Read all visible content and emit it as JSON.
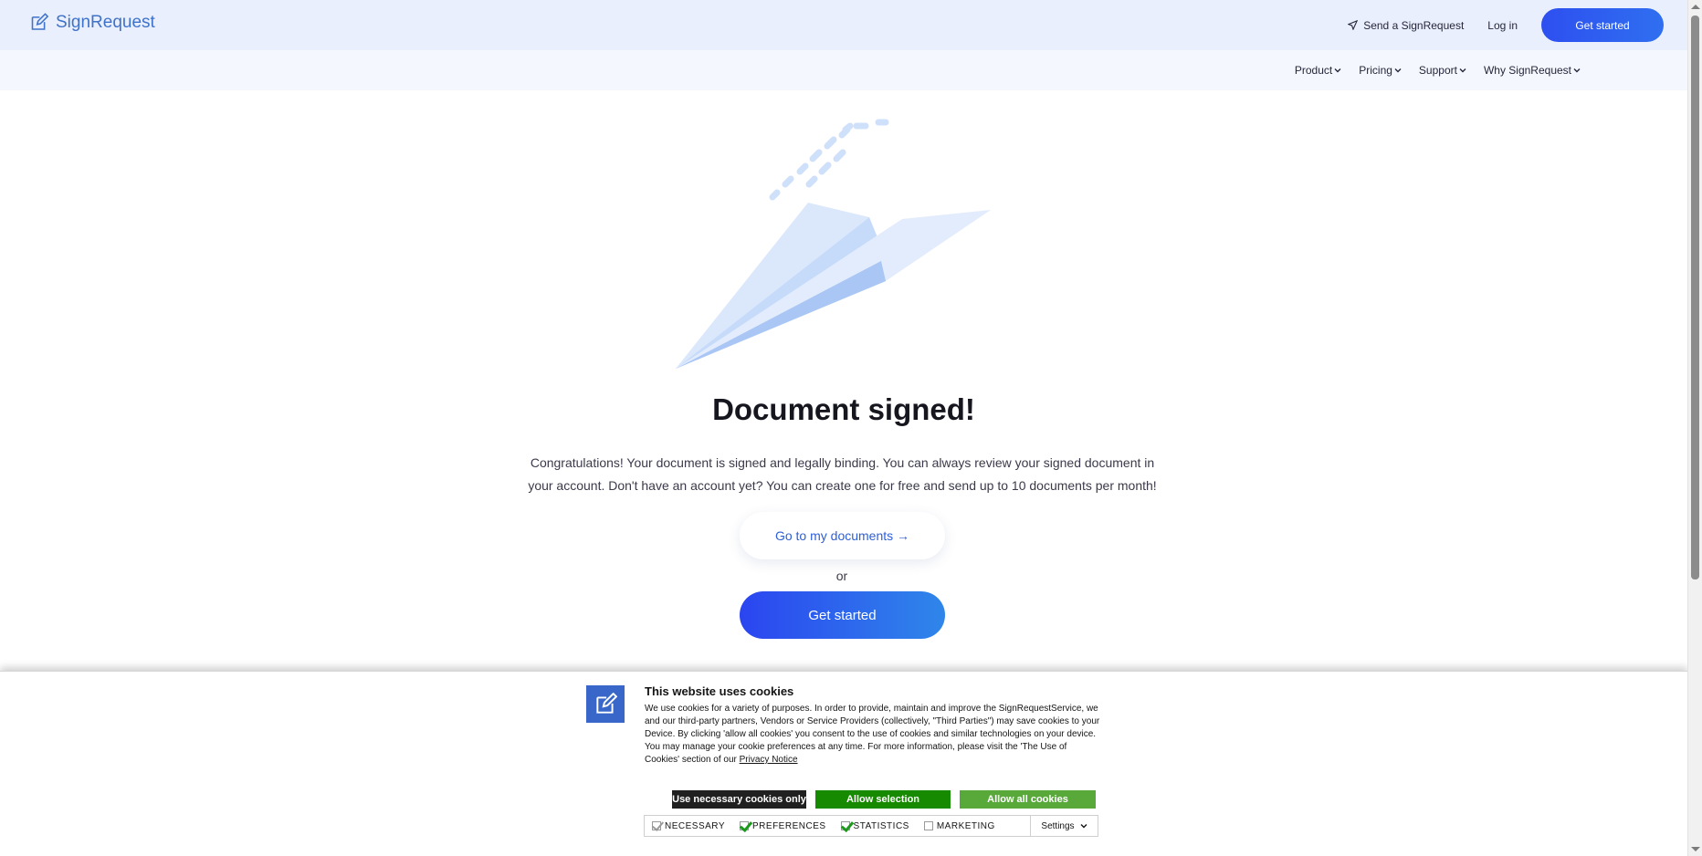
{
  "header": {
    "brand": "SignRequest",
    "send_label": "Send a SignRequest",
    "login_label": "Log in",
    "cta_label": "Get started"
  },
  "subnav": {
    "items": [
      {
        "label": "Product"
      },
      {
        "label": "Pricing"
      },
      {
        "label": "Support"
      },
      {
        "label": "Why SignRequest"
      }
    ]
  },
  "main": {
    "headline": "Document signed!",
    "body": "Congratulations! Your document is signed and legally binding. You can always review your signed document in your account. Don't have an account yet? You can create one for free and send up to 10 documents per month!",
    "docs_button": "Go to my documents →",
    "or_text": "or",
    "cta_label": "Get started"
  },
  "cookies": {
    "title": "This website uses cookies",
    "text": "We use cookies for a variety of purposes. In order to provide, maintain and improve the SignRequestService, we and our third-party partners, Vendors or Service Providers (collectively, \"Third Parties\") may save cookies to your Device. By clicking 'allow all cookies' you consent to the use of cookies and similar technologies on your device. You may manage your cookie preferences at any time. For more information, please visit the 'The Use of Cookies' section of our ",
    "privacy_link": "Privacy Notice",
    "buttons": {
      "necessary": "Use necessary cookies only",
      "selection": "Allow selection",
      "all": "Allow all cookies"
    },
    "toggles": [
      {
        "label": "NECESSARY",
        "checked": true,
        "disabled": true
      },
      {
        "label": "PREFERENCES",
        "checked": true
      },
      {
        "label": "STATISTICS",
        "checked": true
      },
      {
        "label": "MARKETING",
        "checked": false
      }
    ],
    "settings_label": "Settings"
  },
  "colors": {
    "brand": "#3f72c9",
    "primary": "#2e4ff0",
    "topbar_bg": "#e9effd",
    "allow_selection": "#168a00",
    "allow_all": "#58a93a"
  }
}
